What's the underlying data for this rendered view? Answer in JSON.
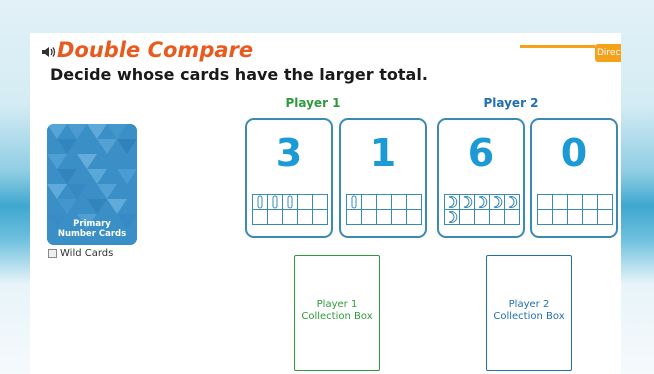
{
  "header": {
    "title": "Double Compare",
    "instruction": "Decide whose cards have the larger total.",
    "directions_tab": "Directions",
    "speaker_icon": "speaker-icon"
  },
  "deck": {
    "label_line1": "Primary",
    "label_line2": "Number Cards",
    "wild_cards_label": "Wild Cards",
    "wild_cards_checked": false
  },
  "players": [
    {
      "name": "Player 1",
      "color": "#2f9a3c",
      "cards": [
        {
          "value": "3",
          "tenframe_count": 3,
          "counter": "bar"
        },
        {
          "value": "1",
          "tenframe_count": 1,
          "counter": "bar"
        }
      ],
      "collection_box": {
        "line1": "Player 1",
        "line2": "Collection Box"
      }
    },
    {
      "name": "Player 2",
      "color": "#1f6fb3",
      "cards": [
        {
          "value": "6",
          "tenframe_count": 6,
          "counter": "moon"
        },
        {
          "value": "0",
          "tenframe_count": 0,
          "counter": "moon"
        }
      ],
      "collection_box": {
        "line1": "Player 2",
        "line2": "Collection Box"
      }
    }
  ],
  "colors": {
    "title": "#e95a1e",
    "card_border": "#3a8ab4",
    "card_number": "#1b9ad6",
    "directions_tab": "#f5a21b"
  }
}
